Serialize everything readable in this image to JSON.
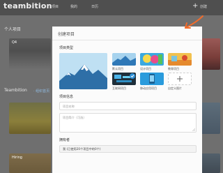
{
  "app": {
    "logo": "teambition",
    "plus": "+"
  },
  "nav": {
    "items": [
      "项目",
      "我的",
      "日历"
    ],
    "right_link": "创建"
  },
  "sections": {
    "personal_title": "个人项目",
    "teambition_title": "Teambition",
    "teambition_link": "· 组织首页"
  },
  "bg_cards": {
    "card1_label": "Q4",
    "card5_label": "Hiring"
  },
  "modal": {
    "title": "创建项目",
    "project_type_label": "项目类型",
    "types": [
      {
        "label": "默认项目",
        "selected": true
      },
      {
        "label": "设计项目",
        "selected": false
      },
      {
        "label": "教育项目",
        "selected": false
      },
      {
        "label": "互联网项目",
        "selected": false
      },
      {
        "label": "移动应用项目",
        "selected": false
      },
      {
        "label": "自定义图片",
        "selected": false
      }
    ],
    "project_info_label": "项目信息",
    "name_placeholder": "项目名称",
    "desc_placeholder": "项目简介（可选）",
    "owner_label": "拥有者",
    "owner_value": "我 (已使用20个项目中的0个)"
  },
  "colors": {
    "accent_orange": "#F26B2A",
    "selected_check": "#2E8FD6"
  }
}
